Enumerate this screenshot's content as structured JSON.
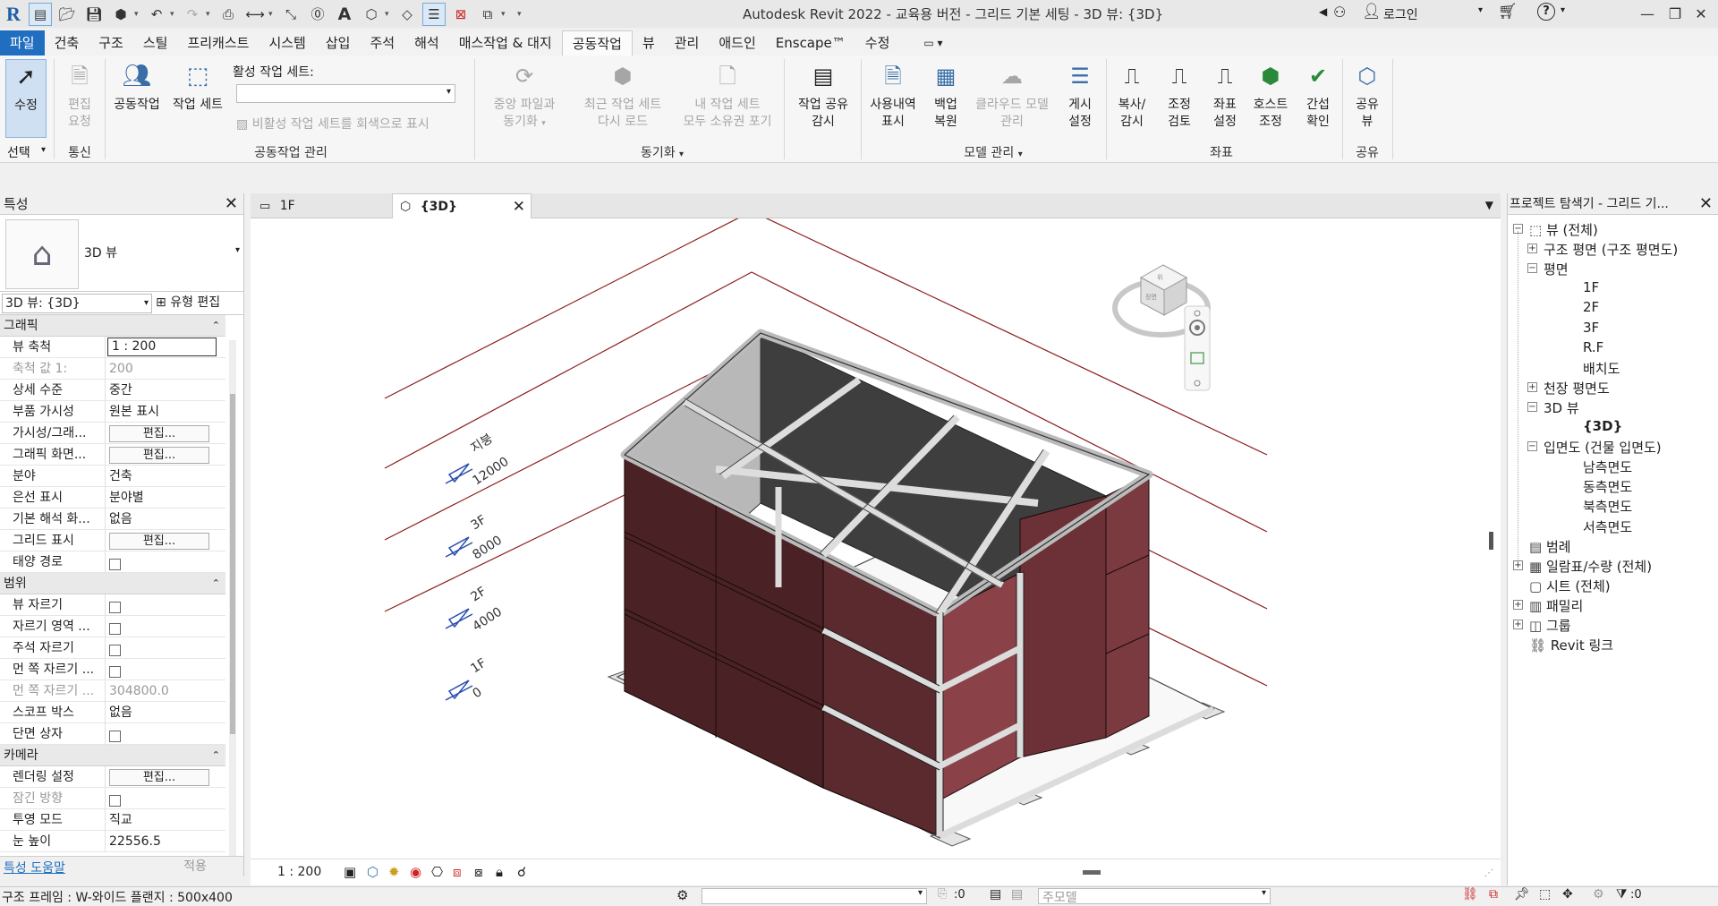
{
  "app": {
    "title": "Autodesk Revit 2022 - 교육용 버전 - 그리드 기본 세팅 - 3D 뷰: {3D}",
    "login": "로그인"
  },
  "tabs": [
    "파일",
    "건축",
    "구조",
    "스틸",
    "프리캐스트",
    "시스템",
    "삽입",
    "주석",
    "해석",
    "매스작업 & 대지",
    "공동작업",
    "뷰",
    "관리",
    "애드인",
    "Enscape™",
    "수정"
  ],
  "active_tab": "공동작업",
  "ribbon": {
    "modify": "수정",
    "select": "선택",
    "edit_request_1": "편집",
    "edit_request_2": "요청",
    "comm": "통신",
    "collab": "공동작업",
    "worksets": "작업 세트",
    "active_workset": "활성 작업 세트:",
    "gray_inactive": "비활성 작업 세트를 회색으로 표시",
    "collab_mgmt": "공동작업 관리",
    "sync_central_1": "중앙 파일과",
    "sync_central_2": "동기화",
    "reload_latest_1": "최근 작업 세트",
    "reload_latest_2": "다시 로드",
    "relinquish_1": "내 작업 세트",
    "relinquish_2": "모두 소유권 포기",
    "sync": "동기화",
    "shared_monitor_1": "작업 공유",
    "shared_monitor_2": "감시",
    "history_1": "사용내역",
    "history_2": "표시",
    "restore_1": "백업",
    "restore_2": "복원",
    "cloud_1": "클라우드 모델",
    "cloud_2": "관리",
    "publish_1": "게시",
    "publish_2": "설정",
    "model_mgmt": "모델 관리",
    "copy_monitor_1": "복사/",
    "copy_monitor_2": "감시",
    "coord_review_1": "조정",
    "coord_review_2": "검토",
    "coord_settings_1": "좌표",
    "coord_settings_2": "설정",
    "host_1": "호스트",
    "host_2": "조정",
    "interference_1": "간섭",
    "interference_2": "확인",
    "coords": "좌표",
    "share_view_1": "공유",
    "share_view_2": "뷰",
    "share": "공유"
  },
  "properties": {
    "title": "특성",
    "type_name": "3D 뷰",
    "instance": "3D 뷰: {3D}",
    "edit_type": "유형 편집",
    "sections": {
      "graphics": "그래픽",
      "extents": "범위",
      "camera": "카메라"
    },
    "graphics_rows": [
      {
        "k": "뷰 축척",
        "v": "1 : 200"
      },
      {
        "k": "축척 값    1:",
        "v": "200"
      },
      {
        "k": "상세 수준",
        "v": "중간"
      },
      {
        "k": "부품 가시성",
        "v": "원본 표시"
      },
      {
        "k": "가시성/그래...",
        "v": "편집..."
      },
      {
        "k": "그래픽 화면...",
        "v": "편집..."
      },
      {
        "k": "분야",
        "v": "건축"
      },
      {
        "k": "은선 표시",
        "v": "분야별"
      },
      {
        "k": "기본 해석 화...",
        "v": "없음"
      },
      {
        "k": "그리드 표시",
        "v": "편집..."
      },
      {
        "k": "태양 경로",
        "v": ""
      }
    ],
    "extents_rows": [
      {
        "k": "뷰 자르기",
        "v": ""
      },
      {
        "k": "자르기 영역 ...",
        "v": ""
      },
      {
        "k": "주석 자르기",
        "v": ""
      },
      {
        "k": "먼 쪽 자르기 ...",
        "v": ""
      },
      {
        "k": "먼 쪽 자르기 ...",
        "v": "304800.0"
      },
      {
        "k": "스코프 박스",
        "v": "없음"
      },
      {
        "k": "단면 상자",
        "v": ""
      }
    ],
    "camera_rows": [
      {
        "k": "렌더링 설정",
        "v": "편집..."
      },
      {
        "k": "잠긴 방향",
        "v": ""
      },
      {
        "k": "투영 모드",
        "v": "직교"
      },
      {
        "k": "눈 높이",
        "v": "22556.5"
      }
    ],
    "help": "특성 도움말",
    "apply": "적용"
  },
  "view_tabs": [
    "1F",
    "{3D}"
  ],
  "viewport": {
    "levels": [
      {
        "name": "지붕",
        "elev": "12000"
      },
      {
        "name": "3F",
        "elev": "8000"
      },
      {
        "name": "2F",
        "elev": "4000"
      },
      {
        "name": "1F",
        "elev": "0"
      }
    ],
    "viewcube_front": "정면",
    "viewcube_top": "위"
  },
  "viewbar": {
    "scale": "1 : 200"
  },
  "browser": {
    "title": "프로젝트 탐색기 - 그리드 기...",
    "nodes": [
      {
        "label": "뷰 (전체)"
      },
      {
        "label": "구조 평면 (구조 평면도)"
      },
      {
        "label": "평면"
      },
      {
        "label": "1F"
      },
      {
        "label": "2F"
      },
      {
        "label": "3F"
      },
      {
        "label": "R.F"
      },
      {
        "label": "배치도"
      },
      {
        "label": "천장 평면도"
      },
      {
        "label": "3D 뷰"
      },
      {
        "label": "{3D}"
      },
      {
        "label": "입면도 (건물 입면도)"
      },
      {
        "label": "남측면도"
      },
      {
        "label": "동측면도"
      },
      {
        "label": "북측면도"
      },
      {
        "label": "서측면도"
      },
      {
        "label": "범례"
      },
      {
        "label": "일람표/수량 (전체)"
      },
      {
        "label": "시트 (전체)"
      },
      {
        "label": "패밀리"
      },
      {
        "label": "그룹"
      },
      {
        "label": "Revit 링크"
      }
    ]
  },
  "status": {
    "text": "구조 프레임 : W-와이드 플랜지 : 500x400",
    "count": ":0",
    "model": "주모델",
    "filter_count": ":0"
  },
  "colors": {
    "file_tab": "#1f6ec0",
    "wall": "#5a2a2e",
    "wall_light": "#7a3a40",
    "level_line": "#8b1a1a"
  }
}
